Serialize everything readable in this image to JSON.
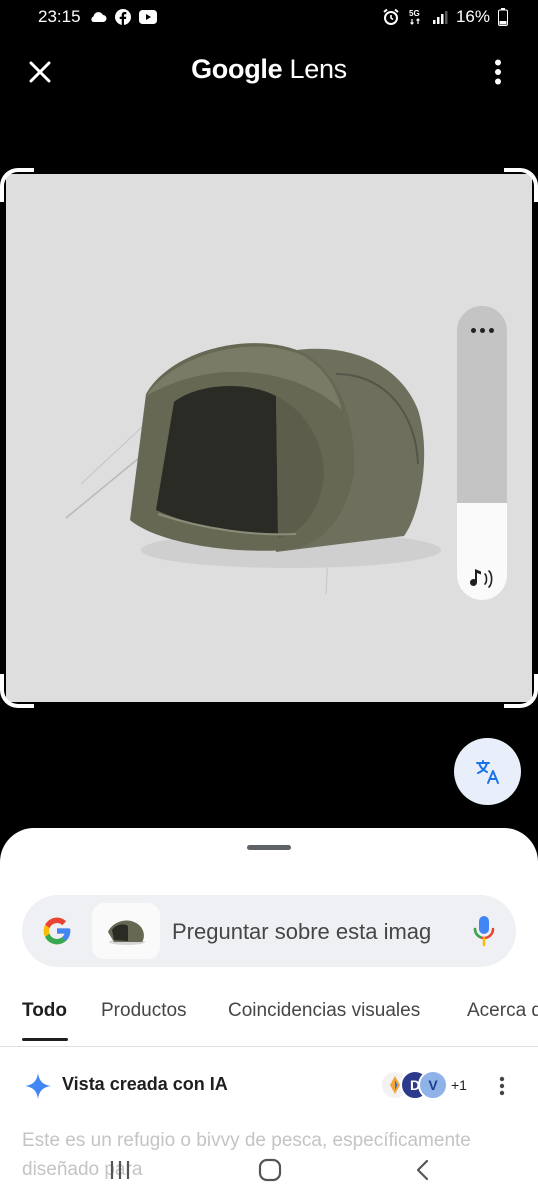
{
  "status_bar": {
    "time": "23:15",
    "battery": "16%",
    "left_icons": [
      "cloud-icon",
      "facebook-icon",
      "youtube-icon"
    ],
    "right_icons": [
      "alarm-icon",
      "5g-icon",
      "signal-icon",
      "battery-icon"
    ]
  },
  "app_bar": {
    "title_brand": "Google",
    "title_product": "Lens"
  },
  "image": {
    "description_icon": "tent-photo",
    "background": "#dedede"
  },
  "side_panel": {
    "more_icon": "more-horiz-icon",
    "sound_icon": "sound-icon"
  },
  "translate_fab": {
    "icon": "translate-icon"
  },
  "search": {
    "placeholder": "Preguntar sobre esta imag"
  },
  "tabs": [
    {
      "label": "Todo",
      "active": true
    },
    {
      "label": "Productos",
      "active": false
    },
    {
      "label": "Coincidencias visuales",
      "active": false
    },
    {
      "label": "Acerca d",
      "active": false
    }
  ],
  "ai_overview": {
    "title": "Vista creada con IA",
    "sources_more": "+1",
    "text": "Este es un refugio o bivvy de pesca, específicamente diseñado para"
  },
  "colors": {
    "google_blue": "#4285F4",
    "google_red": "#EA4335",
    "google_yellow": "#FBBC05",
    "google_green": "#34A853",
    "sheet_bg": "#ffffff",
    "search_bg": "#eef0f3"
  }
}
